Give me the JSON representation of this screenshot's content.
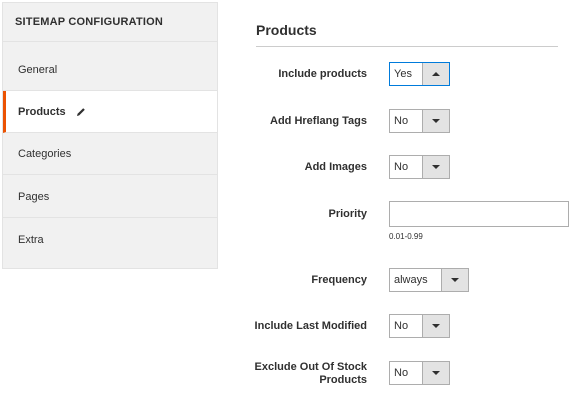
{
  "sidebar": {
    "title": "SITEMAP CONFIGURATION",
    "items": [
      {
        "label": "General"
      },
      {
        "label": "Products",
        "active": true
      },
      {
        "label": "Categories"
      },
      {
        "label": "Pages"
      },
      {
        "label": "Extra"
      }
    ]
  },
  "main": {
    "section_title": "Products",
    "fields": {
      "include_products": {
        "label": "Include products",
        "value": "Yes"
      },
      "add_hreflang": {
        "label": "Add Hreflang Tags",
        "value": "No"
      },
      "add_images": {
        "label": "Add Images",
        "value": "No"
      },
      "priority": {
        "label": "Priority",
        "value": "",
        "hint": "0.01-0.99"
      },
      "frequency": {
        "label": "Frequency",
        "value": "always"
      },
      "include_last_modified": {
        "label": "Include Last Modified",
        "value": "No"
      },
      "exclude_out_of_stock": {
        "label_line1": "Exclude Out Of Stock",
        "label_line2": "Products",
        "value": "No"
      }
    }
  },
  "colors": {
    "accent": "#eb5202",
    "focus": "#007bdb",
    "sidebar_bg": "#f1f1f1"
  },
  "icons": {
    "edit": "pencil-icon",
    "select_open": "arrow-up-icon",
    "select_closed": "arrow-down-icon"
  }
}
